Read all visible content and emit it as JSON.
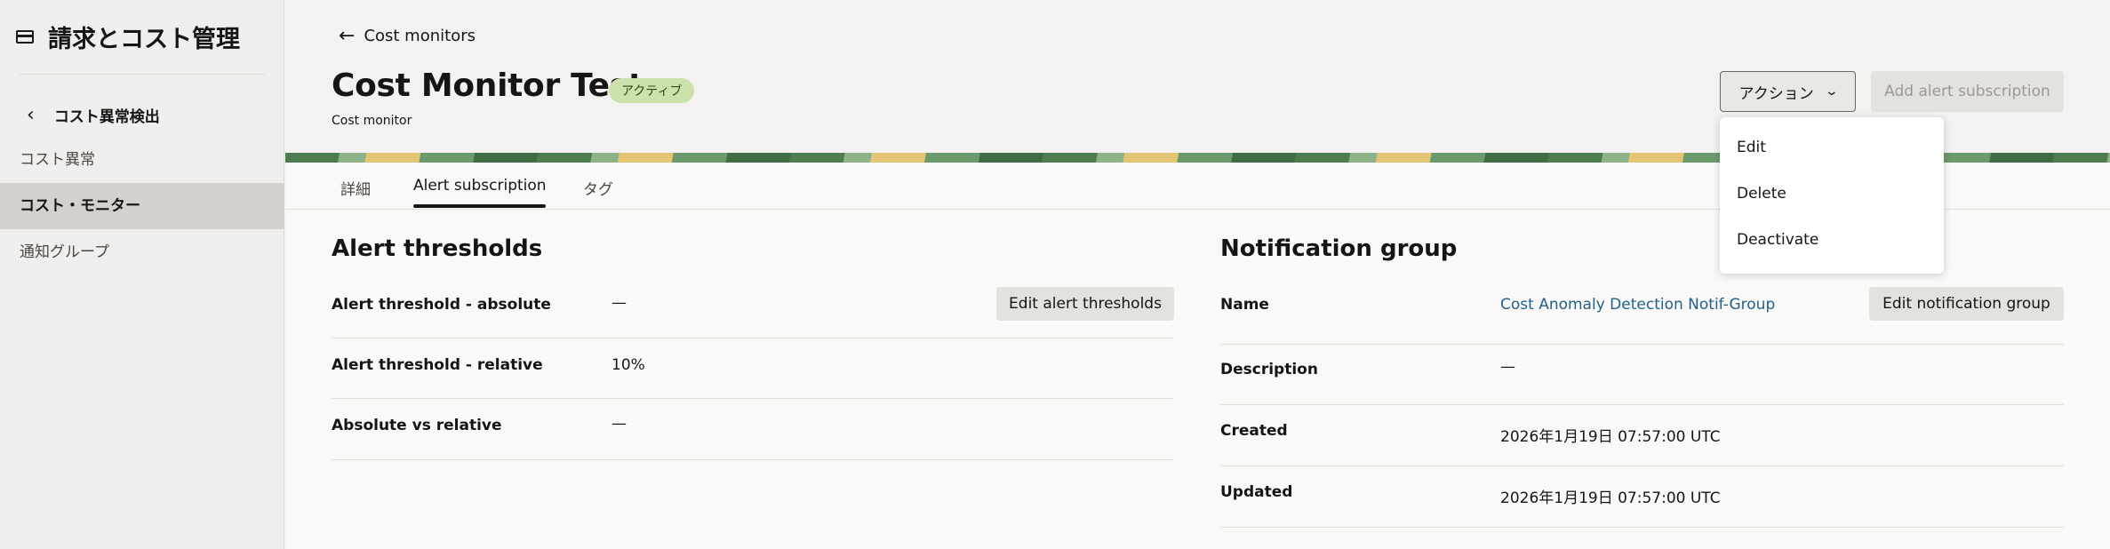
{
  "sidebar": {
    "title": "請求とコスト管理",
    "back_label": "コスト異常検出",
    "items": [
      {
        "label": "コスト異常"
      },
      {
        "label": "コスト・モニター"
      },
      {
        "label": "通知グループ"
      }
    ]
  },
  "header": {
    "breadcrumb": "Cost monitors",
    "title": "Cost Monitor Test",
    "status": "アクティブ",
    "subtitle": "Cost monitor",
    "actions_label": "アクション",
    "add_subscription_label": "Add alert subscription"
  },
  "colors": {
    "accent": "#161513",
    "status_bg": "#cbe2ac",
    "link": "#21618c"
  },
  "tabs": [
    {
      "label": "詳細"
    },
    {
      "label": "Alert subscription"
    },
    {
      "label": "タグ"
    }
  ],
  "active_tab": "Alert subscription",
  "alert_thresholds": {
    "title": "Alert thresholds",
    "edit_label": "Edit alert thresholds",
    "rows": [
      {
        "label": "Alert threshold - absolute",
        "value": "—"
      },
      {
        "label": "Alert threshold - relative",
        "value": "10%"
      },
      {
        "label": "Absolute vs relative",
        "value": "—"
      }
    ]
  },
  "notification_group": {
    "title": "Notification group",
    "edit_label": "Edit notification group",
    "rows": [
      {
        "label": "Name",
        "value": "Cost Anomaly Detection Notif-Group"
      },
      {
        "label": "Description",
        "value": "—"
      },
      {
        "label": "Created",
        "value": "2026年1月19日 07:57:00 UTC"
      },
      {
        "label": "Updated",
        "value": "2026年1月19日 07:57:00 UTC"
      }
    ]
  },
  "actions_menu": {
    "items": [
      {
        "label": "Edit"
      },
      {
        "label": "Delete"
      },
      {
        "label": "Deactivate"
      }
    ]
  }
}
